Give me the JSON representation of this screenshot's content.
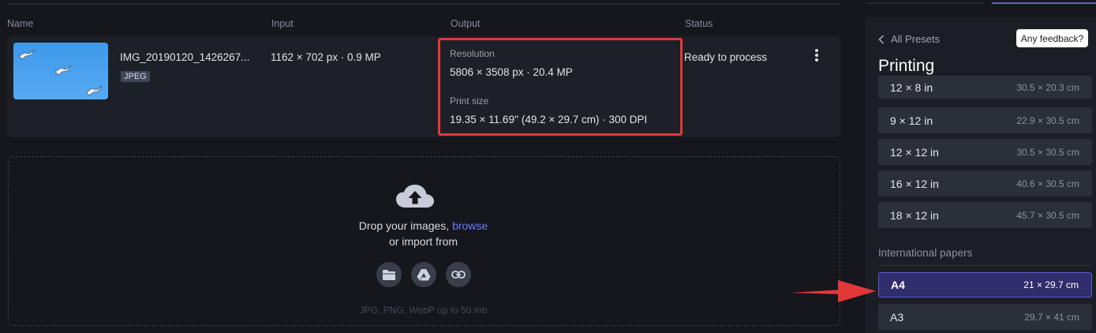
{
  "table": {
    "headers": {
      "name": "Name",
      "input": "Input",
      "output": "Output",
      "status": "Status"
    },
    "file": {
      "name": "IMG_20190120_1426267...",
      "type": "JPEG",
      "input": "1162 × 702 px · 0.9 MP",
      "output": {
        "resolution_label": "Resolution",
        "resolution_value": "5806 × 3508 px · 20.4 MP",
        "print_size_label": "Print size",
        "print_size_value": "19.35 × 11.69'' (49.2 × 29.7 cm) · 300 DPI"
      },
      "status": "Ready to process"
    }
  },
  "dropzone": {
    "prompt": "Drop your images,",
    "browse": "browse",
    "import_text": "or import from",
    "sources": [
      "folder-icon",
      "google-drive-icon",
      "link-icon"
    ],
    "formats": "JPG, PNG, WebP up to 50 mb"
  },
  "sidebar": {
    "back_label": "All Presets",
    "feedback_label": "Any feedback?",
    "title": "Printing",
    "presets": [
      {
        "label": "12 × 8 in",
        "size": "30.5 × 20.3 cm"
      },
      {
        "label": "9 × 12 in",
        "size": "22.9 × 30.5 cm"
      },
      {
        "label": "12 × 12 in",
        "size": "30.5 × 30.5 cm"
      },
      {
        "label": "16 × 12 in",
        "size": "40.6 × 30.5 cm"
      },
      {
        "label": "18 × 12 in",
        "size": "45.7 × 30.5 cm"
      }
    ],
    "group_title": "International papers",
    "papers": [
      {
        "label": "A4",
        "size": "21 × 29.7 cm",
        "selected": true
      },
      {
        "label": "A3",
        "size": "29.7 × 41 cm",
        "selected": false
      }
    ]
  },
  "colors": {
    "accent": "#6e78ff",
    "highlight": "#e2383a",
    "selected_bg": "#2f2d6b",
    "background": "#15171c"
  }
}
